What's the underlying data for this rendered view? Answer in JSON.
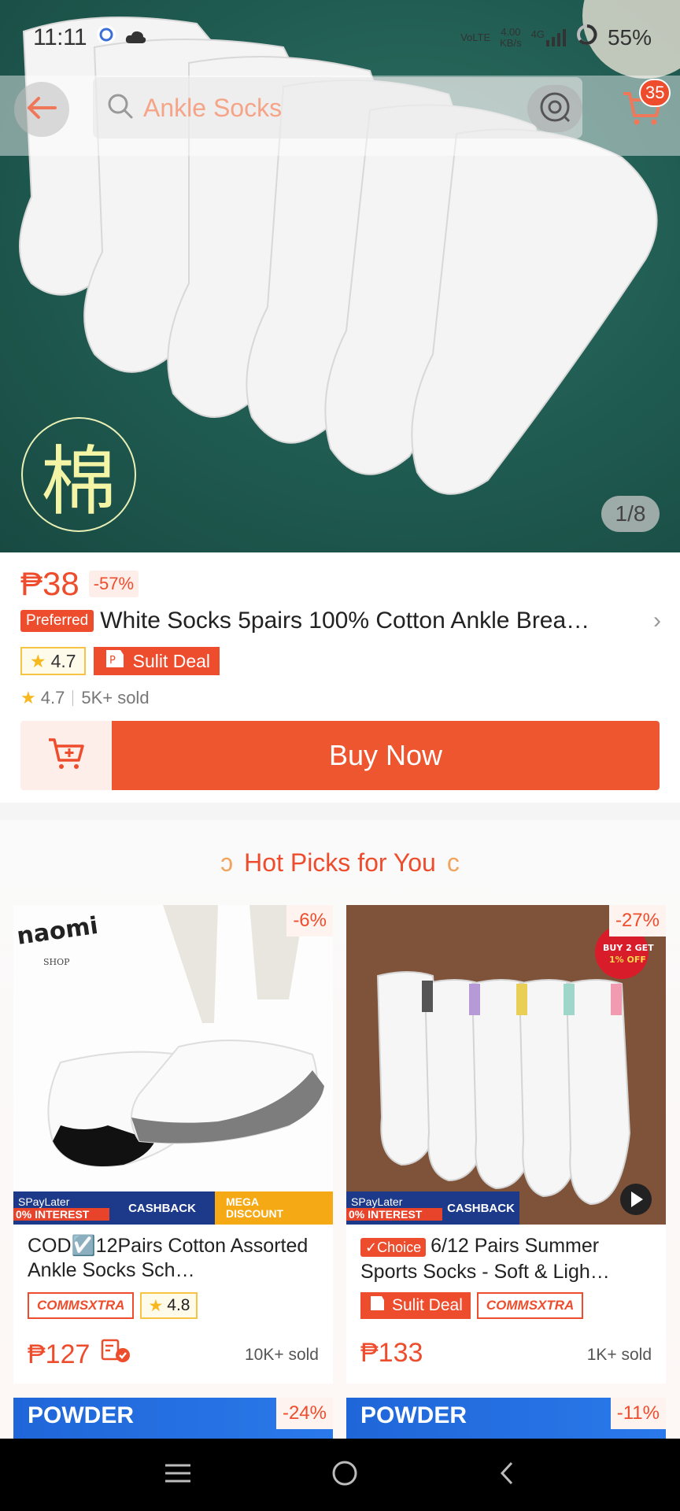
{
  "status_bar": {
    "time": "11:11",
    "network_top": "VoLTE",
    "speed": "4.00",
    "speed_unit": "KB/s",
    "signal": "4G",
    "battery": "55%"
  },
  "header": {
    "search_placeholder": "Ankle Socks",
    "cart_count": "35"
  },
  "hero": {
    "badge_char": "棉",
    "image_counter": "1/8"
  },
  "product": {
    "price": "₱38",
    "discount": "-57%",
    "preferred_label": "Preferred",
    "title": "White Socks 5pairs 100% Cotton Ankle Brea…",
    "rating": "4.7",
    "deal_label": "Sulit Deal",
    "meta_rating": "4.7",
    "sold": "5K+ sold",
    "buy_now": "Buy Now"
  },
  "hot_picks": {
    "title": "Hot Picks for You",
    "items": [
      {
        "discount": "-6%",
        "brand": "naomi",
        "brand_sub": "SHOP",
        "promo_spay": "SPayLater",
        "promo_interest": "0% INTEREST",
        "promo_cashback": "CASHBACK",
        "promo_mega": "MEGA",
        "promo_discount": "DISCOUNT",
        "title": "COD☑️12Pairs Cotton Assorted Ankle Socks Sch…",
        "tag_xtra": "COMMSXTRA",
        "rating": "4.8",
        "price": "₱127",
        "sold": "10K+ sold"
      },
      {
        "discount": "-27%",
        "buy2_line1": "BUY 2 GET",
        "buy2_line2": "1% OFF",
        "promo_spay": "SPayLater",
        "promo_interest": "0% INTEREST",
        "promo_cashback": "CASHBACK",
        "choice_label": "✓Choice",
        "title": "6/12 Pairs Summer Sports Socks - Soft & Ligh…",
        "deal_label": "Sulit Deal",
        "tag_xtra": "COMMSXTRA",
        "price": "₱133",
        "sold": "1K+ sold"
      }
    ],
    "next_items": [
      {
        "label": "POWDER",
        "discount": "-24%"
      },
      {
        "label": "POWDER",
        "discount": "-11%"
      }
    ]
  },
  "colors": {
    "accent": "#ee4d2d",
    "hero_bg": "#1f5a50"
  }
}
